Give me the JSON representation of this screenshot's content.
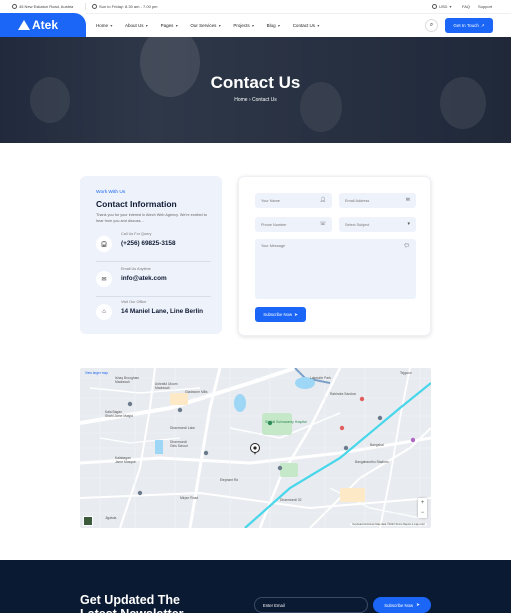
{
  "topbar": {
    "address": "45 New Eskaton Road, Austria",
    "hours": "Sun to Friday: 8.30 am - 7.00 pm",
    "currency": "USD",
    "faq": "FAQ",
    "support": "Support"
  },
  "brand": {
    "name": "Atek",
    "color": "#1b66f6"
  },
  "nav": {
    "items": [
      "Home",
      "About Us",
      "Pages",
      "Our Services",
      "Projects",
      "Blog",
      "Contact Us"
    ],
    "cta": "Get In Touch"
  },
  "hero": {
    "title": "Contact Us",
    "breadcrumb_home": "Home",
    "breadcrumb_sep": "›",
    "breadcrumb_current": "Contact Us"
  },
  "contact": {
    "eyebrow": "Work With Us",
    "title": "Contact Information",
    "description": "Thank you for your interest in Atech Web Agency. We're excited to hear from you and discuss...",
    "rows": [
      {
        "label": "Call Us For Query",
        "value": "(+256) 69825-3158",
        "icon": "headphones-icon"
      },
      {
        "label": "Email Us Anytime",
        "value": "info@atek.com",
        "icon": "envelope-icon"
      },
      {
        "label": "Visit Our Office",
        "value": "14 Maniel Lane, Line Berlin",
        "icon": "building-icon"
      }
    ]
  },
  "form": {
    "name_placeholder": "Your Name",
    "email_placeholder": "Email Address",
    "phone_placeholder": "Phone Number",
    "subject_placeholder": "Select Subject",
    "message_placeholder": "Your Message",
    "submit": "Subscribe Now"
  },
  "map": {
    "view_larger": "View larger map",
    "labels": [
      "Ishaq Brougham\nMadrasah",
      "Ashraful Uloom\nMadrasah",
      "Gladstone Mills",
      "Kala Bagan\nShahi Jame Masjid",
      "Dhanmondi Lake",
      "Lakeside Park",
      "Shahid Suhrawardy Hospital",
      "Rabindra Sarobar",
      "Bangabandhu Stadium",
      "Dhanmondi\nGirls School",
      "Kalabagan\nJame Mosque",
      "Tejgaon",
      "Dhanmondi 32",
      "Mirpur Road",
      "Bangshal",
      "Elephant Rd",
      "Jigatola"
    ],
    "attribution": "Keyboard shortcuts   Map data ©2024   Terms   Report a map error"
  },
  "newsletter": {
    "title": "Get Updated The Latest Newsletter",
    "email_placeholder": "Enter Email",
    "button": "Subscribe Now"
  }
}
